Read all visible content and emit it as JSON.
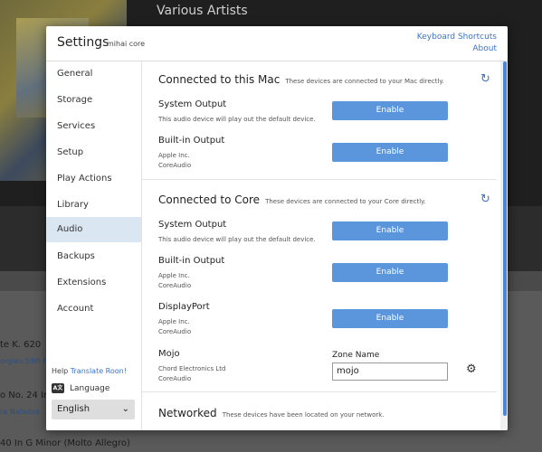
{
  "background": {
    "artist": "Various Artists",
    "tracks": [
      {
        "title": "te K. 620",
        "subtitle": "orgian SIMI Fes"
      },
      {
        "title": "o No. 24 In",
        "subtitle": "ra Natadze"
      },
      {
        "title": "40 In G Minor (Molto Allegro)",
        "subtitle": ""
      }
    ]
  },
  "modal": {
    "title": "Settings",
    "subtitle": "mihai core",
    "links": [
      "Keyboard Shortcuts",
      "About"
    ]
  },
  "sidebar": {
    "items": [
      {
        "label": "General"
      },
      {
        "label": "Storage"
      },
      {
        "label": "Services"
      },
      {
        "label": "Setup"
      },
      {
        "label": "Play Actions"
      },
      {
        "label": "Library"
      },
      {
        "label": "Audio",
        "active": true
      },
      {
        "label": "Backups"
      },
      {
        "label": "Extensions"
      },
      {
        "label": "Account"
      }
    ],
    "help_prefix": "Help",
    "help_link": "Translate Roon!",
    "language_icon": "A文",
    "language_label": "Language",
    "language_value": "English"
  },
  "sections": {
    "mac": {
      "title": "Connected to this Mac",
      "note": "These devices are connected to your Mac directly.",
      "devices": [
        {
          "name": "System Output",
          "sub1": "This audio device will play out the default device.",
          "sub2": "",
          "button": "Enable"
        },
        {
          "name": "Built-in Output",
          "sub1": "Apple Inc.",
          "sub2": "CoreAudio",
          "button": "Enable"
        }
      ]
    },
    "core": {
      "title": "Connected to Core",
      "note": "These devices are connected to your Core directly.",
      "devices": [
        {
          "name": "System Output",
          "sub1": "This audio device will play out the default device.",
          "sub2": "",
          "button": "Enable"
        },
        {
          "name": "Built-in Output",
          "sub1": "Apple Inc.",
          "sub2": "CoreAudio",
          "button": "Enable"
        },
        {
          "name": "DisplayPort",
          "sub1": "Apple Inc.",
          "sub2": "CoreAudio",
          "button": "Enable"
        },
        {
          "name": "Mojo",
          "sub1": "Chord Electronics Ltd",
          "sub2": "CoreAudio",
          "zone_label": "Zone Name",
          "zone_value": "mojo"
        }
      ]
    },
    "networked": {
      "title": "Networked",
      "note": "These devices have been located on your network."
    }
  },
  "icons": {
    "refresh": "refresh-icon",
    "gear": "gear-icon",
    "chevron": "chevron-down-icon"
  },
  "colors": {
    "accent": "#5b96dc",
    "link": "#3b74c6",
    "active_nav": "#dbe6f3"
  }
}
